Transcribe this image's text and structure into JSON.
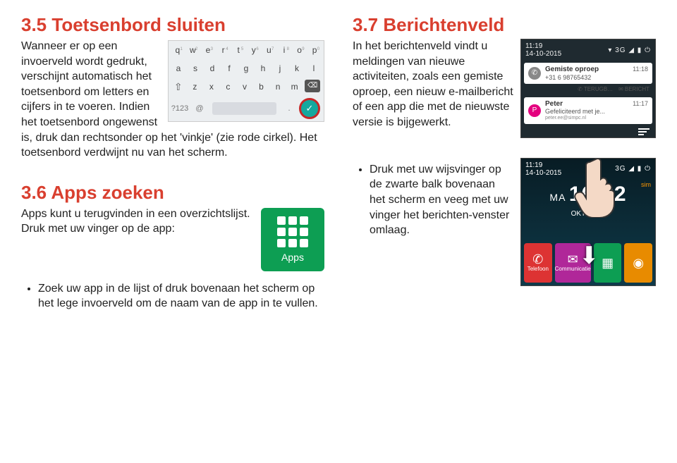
{
  "left": {
    "sec35": {
      "heading": "3.5 Toetsenbord sluiten",
      "para1_a": "Wanneer er op een invoerveld wordt gedrukt, verschijnt automatisch het toetsenbord om letters en cijfers in te voeren. Indien het toetsenbord ongewenst is, druk dan rechtsonder op het 'vinkje' (zie rode cirkel). Het toetsenbord verdwijnt nu van het scherm.",
      "kb": {
        "mode": "?123",
        "at": "@",
        "dot": "."
      }
    },
    "sec36": {
      "heading": "3.6 Apps zoeken",
      "para": "Apps kunt u terugvinden in een overzichtslijst. Druk met uw vinger op de app:",
      "tile_label": "Apps",
      "bullet1": "Zoek uw app in de lijst of druk bovenaan het scherm op het lege invoerveld om de naam van de app in te vullen."
    }
  },
  "right": {
    "sec37": {
      "heading": "3.7 Berichtenveld",
      "para": "In het berichtenveld vindt u meldingen van nieuwe activiteiten, zoals een gemiste oproep, een nieuw e-mailbericht of een app die met de nieuwste versie is bijgewerkt.",
      "notif": {
        "time": "11:19",
        "date": "14-10-2015",
        "sig": "3G",
        "card1": {
          "title": "Gemiste oproep",
          "sub": "+31 6 98765432",
          "time": "11:18",
          "btn_back": "TERUGB…",
          "btn_msg": "BERICHT"
        },
        "card2": {
          "title": "Peter",
          "sub": "Gefeliciteerd met je...",
          "src": "peter.ee@simpc.nl",
          "time": "11:17",
          "avatar": "P"
        }
      }
    },
    "sec_pull": {
      "bullet": "Druk met uw wijsvinger op de zwarte balk bovenaan het scherm en veeg met uw vinger het berichten-venster omlaag.",
      "home": {
        "time": "11:19",
        "date": "14-10-2015",
        "sig": "3G",
        "sim": "sim",
        "day": "MA",
        "clock": "16:32",
        "month": "OKTOBER",
        "tiles": {
          "tel": "Telefoon",
          "com": "Communicatie"
        }
      }
    }
  }
}
